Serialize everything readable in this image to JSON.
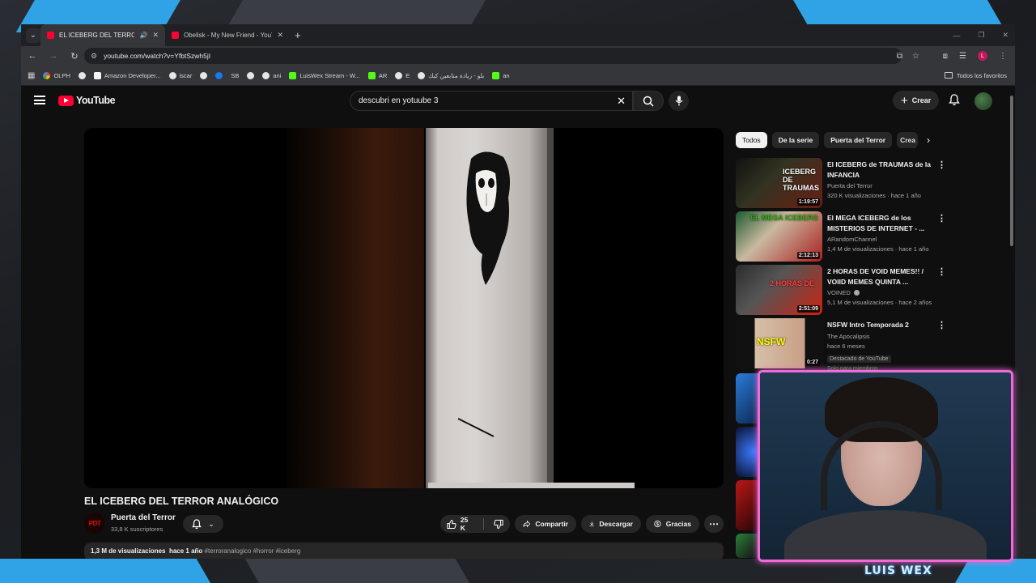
{
  "browser": {
    "tabs": [
      {
        "title": "EL ICEBERG DEL TERROR ANALÓGICO",
        "active": true
      },
      {
        "title": "Obelisk - My New Friend - YouTube",
        "active": false
      }
    ],
    "url": "youtube.com/watch?v=YfbtSzwh5jI",
    "bookmarks": [
      {
        "label": "OLPH",
        "icon": "google-icon"
      },
      {
        "label": "",
        "icon": "globe-icon"
      },
      {
        "label": "Amazon Developer...",
        "icon": "amazon-icon"
      },
      {
        "label": "iscar",
        "icon": "globe-icon"
      },
      {
        "label": "",
        "icon": "globe-icon"
      },
      {
        "label": "",
        "icon": "facebook-icon"
      },
      {
        "label": "SB",
        "icon": "youtube-icon"
      },
      {
        "label": "",
        "icon": "globe-icon"
      },
      {
        "label": "ani",
        "icon": "globe-icon"
      },
      {
        "label": "LuisWex Stream - W...",
        "icon": "kick-icon"
      },
      {
        "label": "AR",
        "icon": "kick-icon"
      },
      {
        "label": "E",
        "icon": "globe-icon"
      },
      {
        "label": "بلو - زيادة متابعين كيك",
        "icon": "globe-icon"
      },
      {
        "label": "an",
        "icon": "kick-icon"
      }
    ],
    "all_bookmarks": "Todos los favoritos",
    "profile_initial": "L"
  },
  "youtube": {
    "logo_text": "YouTube",
    "search_value": "descubri en yotuube 3",
    "create_label": "Crear",
    "video": {
      "title": "EL ICEBERG DEL TERROR ANALÓGICO",
      "channel": "Puerta del Terror",
      "channel_logo": "PDT",
      "subscribers": "33,8 K suscriptores",
      "likes": "25 K",
      "share": "Compartir",
      "download": "Descargar",
      "thanks": "Gracias",
      "views": "1,3 M de visualizaciones",
      "age": "hace 1 año",
      "tags": "#terroranalogico #horror #iceberg"
    },
    "chips": [
      "Todos",
      "De la serie",
      "Puerta del Terror",
      "Crea"
    ],
    "recommendations": [
      {
        "title": "El ICEBERG de TRAUMAS de la INFANCIA",
        "channel": "Puerta del Terror",
        "views": "320 K visualizaciones · hace 1 año",
        "duration": "1:19:57",
        "thumb_text": "ICEBERG DE TRAUMAS"
      },
      {
        "title": "El MEGA ICEBERG de los MISTERIOS DE INTERNET - ...",
        "channel": "ARandomChannel",
        "views": "1,4 M de visualizaciones · hace 1 año",
        "duration": "2:12:13",
        "thumb_text": "EL MEGA ICEBERG"
      },
      {
        "title": "2 HORAS DE VOID MEMES!! / VOIID MEMES QUINTA ...",
        "channel": "VOINED",
        "views": "5,1 M de visualizaciones · hace 2 años",
        "duration": "2:51:09",
        "thumb_text": "2 HORAS DE"
      },
      {
        "title": "NSFW Intro Temporada 2",
        "channel": "The Apocalipsis",
        "views": "hace 6 meses",
        "duration": "0:27",
        "badge": "Destacado de YouTube",
        "members": "Solo para miembros",
        "thumb_text": "NSFW"
      }
    ]
  },
  "stream": {
    "streamer_name": "LUIS WEX",
    "accent_color": "#f06bd8",
    "brand_color": "#ff0033"
  }
}
